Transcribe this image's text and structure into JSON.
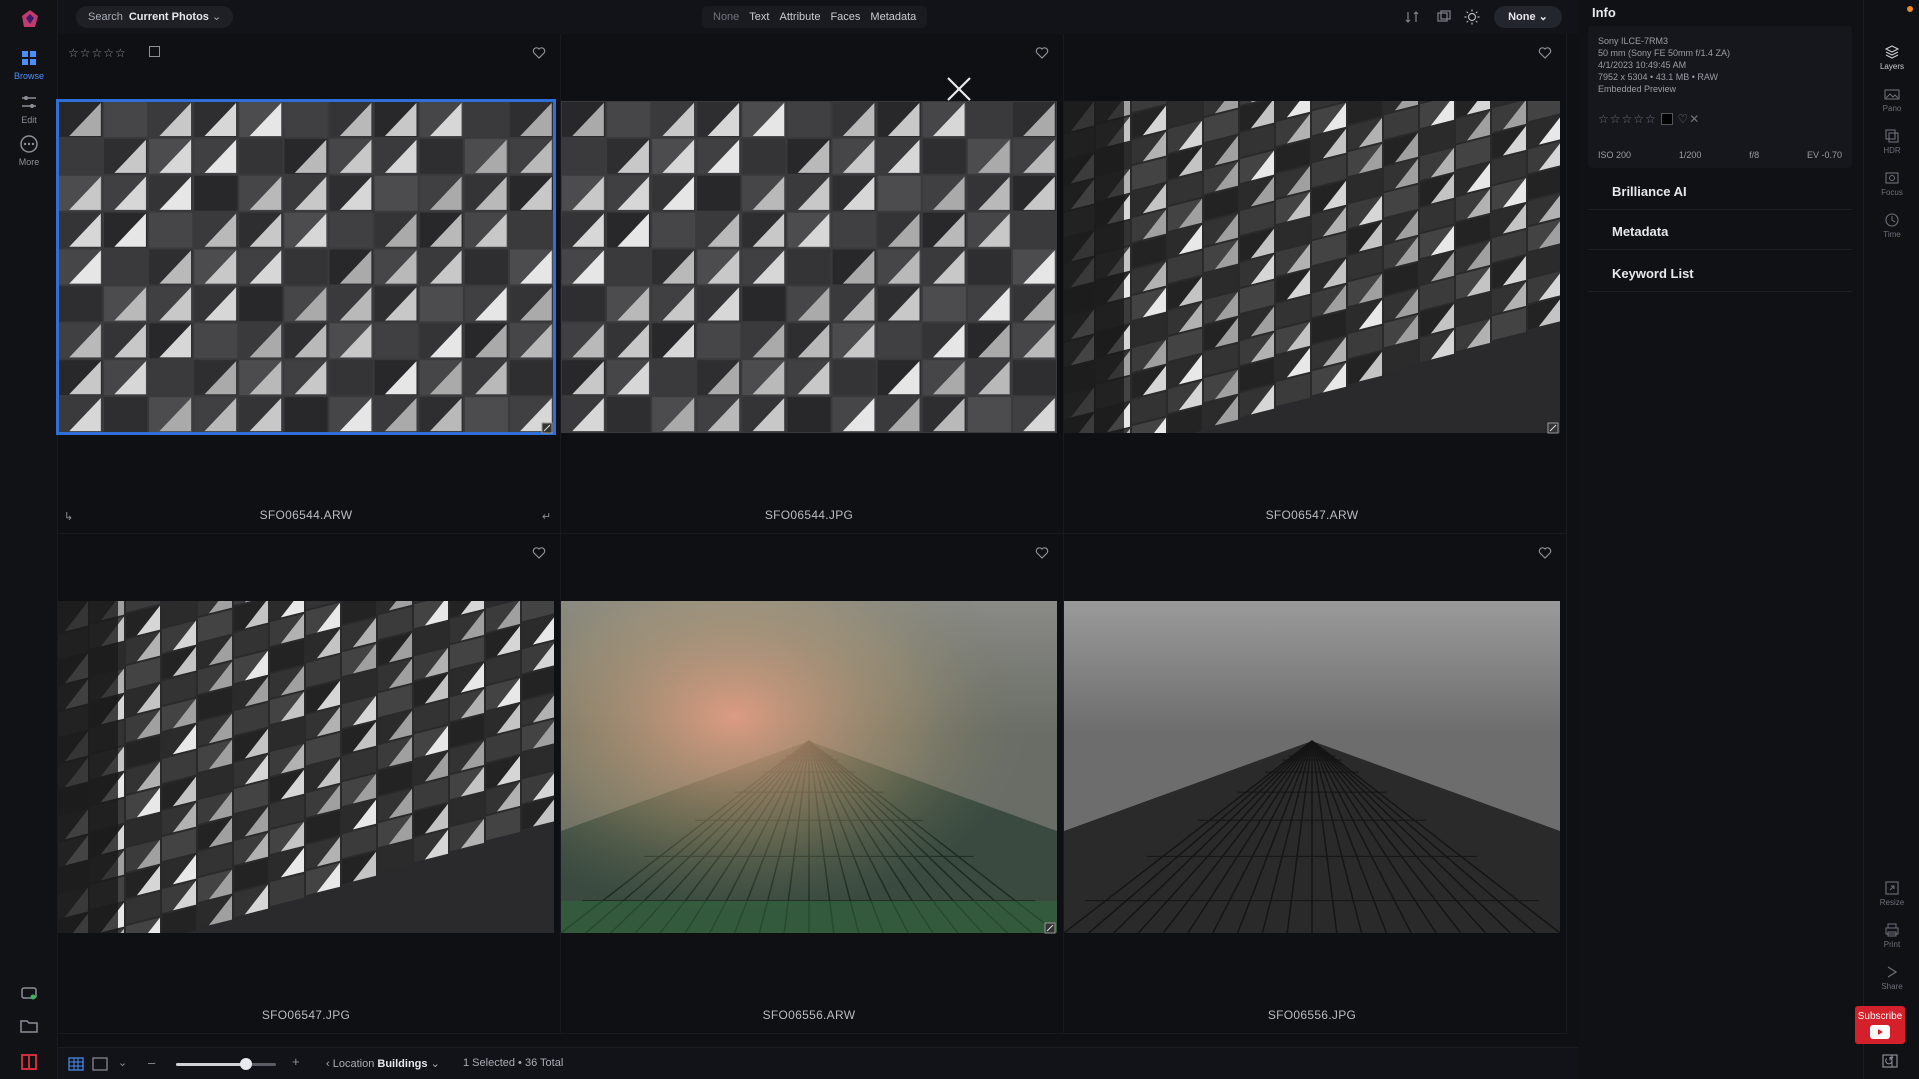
{
  "rail": {
    "items": [
      {
        "label": "Browse",
        "icon": "grid-icon"
      },
      {
        "label": "Edit",
        "icon": "sliders-icon"
      },
      {
        "label": "More",
        "icon": "more-icon"
      }
    ]
  },
  "topbar": {
    "search_label": "Search",
    "search_scope": "Current Photos",
    "filters": [
      "None",
      "Text",
      "Attribute",
      "Faces",
      "Metadata"
    ],
    "none_button": "None"
  },
  "grid": {
    "stars": "☆☆☆☆☆",
    "photos": [
      {
        "name": "SFO06544.ARW",
        "style": "tiles-front",
        "selected": true
      },
      {
        "name": "SFO06544.JPG",
        "style": "tiles-front",
        "selected": false
      },
      {
        "name": "SFO06547.ARW",
        "style": "tiles-angle",
        "selected": false
      },
      {
        "name": "SFO06547.JPG",
        "style": "tiles-angle",
        "selected": false
      },
      {
        "name": "SFO06556.ARW",
        "style": "tower-flare",
        "selected": false
      },
      {
        "name": "SFO06556.JPG",
        "style": "tower-mono",
        "selected": false
      }
    ]
  },
  "bottombar": {
    "zoom_level": 0.7,
    "location_label": "Location",
    "location_value": "Buildings",
    "selection": "1 Selected • 36 Total"
  },
  "info": {
    "title": "Info",
    "camera": "Sony ILCE-7RM3",
    "lens": "50 mm (Sony FE 50mm f/1.4 ZA)",
    "datetime": "4/1/2023 10:49:45 AM",
    "size": "7952 x 5304 • 43.1 MB • RAW",
    "preview": "Embedded Preview",
    "rating_stars": "☆☆☆☆☆",
    "exif": [
      "ISO 200",
      "1/200",
      "f/8",
      "EV -0.70"
    ],
    "sections": [
      "Brilliance AI",
      "Metadata",
      "Keyword List"
    ]
  },
  "rrail": {
    "top_items": [
      "Layers",
      "Pano",
      "HDR",
      "Focus",
      "Time"
    ],
    "bottom_items": [
      "Resize",
      "Print",
      "Share"
    ]
  },
  "subscribe_label": "Subscribe",
  "colors": {
    "accent": "#2e6fd8",
    "background": "#0f1014",
    "subscribe": "#d3202a"
  }
}
